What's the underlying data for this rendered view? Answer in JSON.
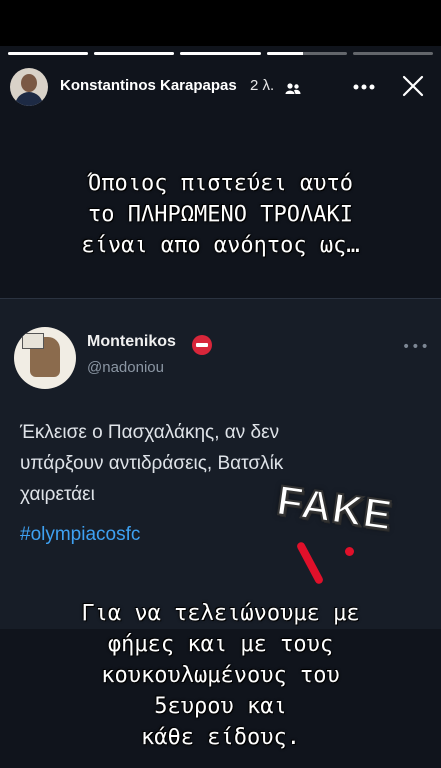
{
  "story": {
    "progress": [
      1,
      1,
      1,
      0.45,
      0
    ],
    "author": "Konstantinos Karapapas",
    "time": "2 λ.",
    "icons": {
      "group": "group-icon",
      "more": "more-icon",
      "close": "close-icon"
    },
    "caption_top": [
      "Όποιος πιστεύει αυτό",
      "το ΠΛΗΡΩΜΕΝΟ ΤΡΟΛΑΚΙ",
      "είναι απο ανόητος ως…"
    ],
    "caption_bottom": [
      "Για να τελειώνουμε με",
      "φήμες και με τους",
      "κουκουλωμένους του",
      "5ευρου και",
      "κάθε είδους."
    ],
    "sticker_text": "FAKE"
  },
  "tweet": {
    "name": "Montenikos",
    "handle": "@nadoniou",
    "more": "•••",
    "text": [
      "Έκλεισε ο Πασχαλάκης, αν δεν",
      "υπάρξουν αντιδράσεις, Βατσλίκ",
      "χαιρετάει"
    ],
    "hashtag": "#olympiacosfc"
  },
  "colors": {
    "background": "#10141c",
    "tweet_card": "#171d27",
    "hashtag": "#3ea1f2",
    "accent_red": "#e0102a"
  }
}
